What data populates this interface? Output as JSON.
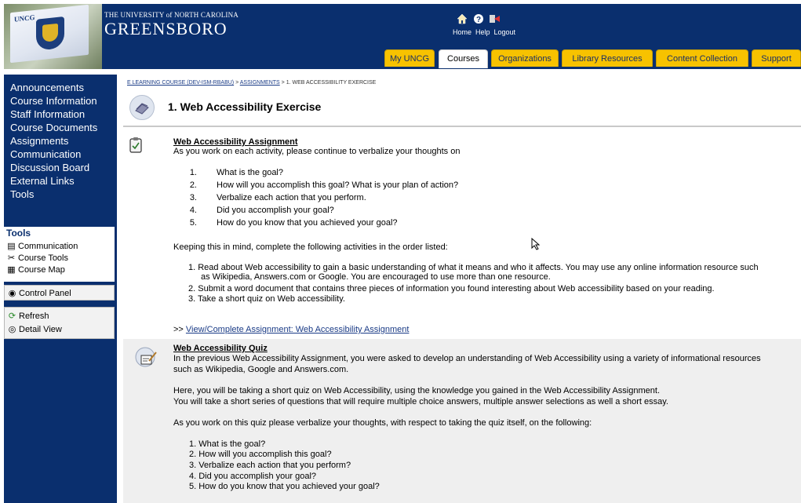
{
  "header": {
    "university_line1": "THE UNIVERSITY of NORTH CAROLINA",
    "university_line2": "GREENSBORO",
    "logo_tag": "UNCG",
    "top_links": [
      "Home",
      "Help",
      "Logout"
    ],
    "tabs": [
      {
        "label": "My UNCG"
      },
      {
        "label": "Courses"
      },
      {
        "label": "Organizations"
      },
      {
        "label": "Library Resources"
      },
      {
        "label": "Content Collection"
      },
      {
        "label": "Support"
      }
    ],
    "active_tab": "Courses"
  },
  "sidebar": {
    "items": [
      {
        "label": "Announcements"
      },
      {
        "label": "Course Information"
      },
      {
        "label": "Staff Information"
      },
      {
        "label": "Course Documents"
      },
      {
        "label": "Assignments"
      },
      {
        "label": "Communication"
      },
      {
        "label": "Discussion Board"
      },
      {
        "label": "External Links"
      },
      {
        "label": "Tools"
      }
    ],
    "tools_box": {
      "title": "Tools",
      "items": [
        {
          "label": "Communication",
          "icon": "communication-icon"
        },
        {
          "label": "Course Tools",
          "icon": "course-tools-icon"
        },
        {
          "label": "Course Map",
          "icon": "course-map-icon"
        }
      ]
    },
    "control_panel": {
      "label": "Control Panel",
      "icon": "control-panel-icon"
    },
    "bottom_box": {
      "items": [
        {
          "label": "Refresh",
          "icon": "refresh-icon"
        },
        {
          "label": "Detail View",
          "icon": "detail-view-icon"
        }
      ]
    }
  },
  "breadcrumb": {
    "course": "E LEARNING COURSE (DEV-ISM-RBABU)",
    "sep1": ">",
    "assignments": "ASSIGNMENTS",
    "sep2": ">",
    "current": "1. WEB ACCESSIBILITY EXERCISE"
  },
  "page_title": "1. Web Accessibility Exercise",
  "assignment": {
    "title": "Web Accessibility Assignment",
    "intro": "As you work on each activity, please continue to verbalize your thoughts on",
    "questions": [
      "What is the goal?",
      "How will you accomplish this goal? What is your plan of action?",
      "Verbalize each action that you perform.",
      "Did you accomplish your goal?",
      "How do you know that you achieved your goal?"
    ],
    "keeping": "Keeping this in mind, complete the following activities in the order listed:",
    "activities": [
      "Read about Web accessibility to gain a basic understanding of what it means and who it affects. You may use any online information resource such",
      "as Wikipedia, Answers.com or Google. You are encouraged to use more than one resource.",
      "Submit a word document that contains three pieces of information you found interesting about Web accessibility based on your reading.",
      "Take a short quiz on Web accessibility."
    ],
    "link_prefix": ">>",
    "link_label": "View/Complete Assignment: Web Accessibility Assignment"
  },
  "quiz": {
    "title": "Web Accessibility Quiz",
    "line1": " In the previous Web Accessibility Assignment, you were asked to develop an understanding of Web Accessibility using a variety of informational resources",
    "line2": "such as Wikipedia, Google and Answers.com.",
    "para2_line1": "Here, you will be taking a short quiz on Web Accessibility, using the knowledge you gained in the Web Accessibility Assignment.",
    "para2_line2": "You will take a short series of questions that will require multiple choice answers, multiple answer selections as well a short essay.",
    "para3": "As you work on this quiz please verbalize your thoughts, with respect to taking the quiz itself, on the following:",
    "questions": [
      "What is the goal?",
      "How will you accomplish this goal?",
      "Verbalize each action that you perform?",
      "Did you accomplish your goal?",
      "How do you know that you achieved your goal?"
    ]
  },
  "colors": {
    "navy": "#0a2f6e",
    "tab_gold": "#f7c200",
    "link_blue": "#1a3b86"
  }
}
